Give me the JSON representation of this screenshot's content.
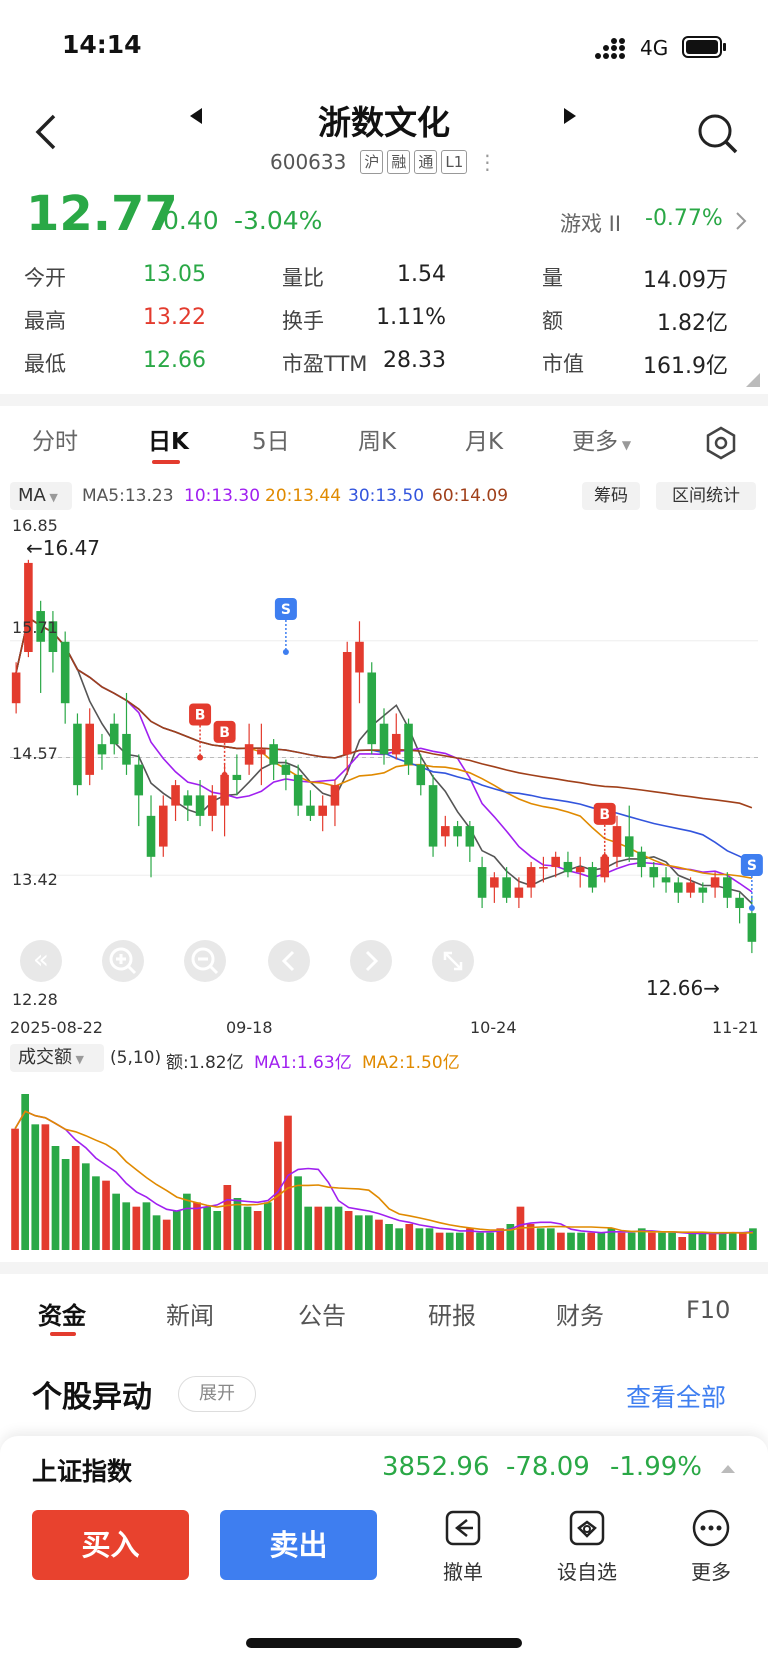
{
  "status_bar": {
    "time": "14:14",
    "network": "4G"
  },
  "header": {
    "title": "浙数文化",
    "code": "600633",
    "tags": [
      "沪",
      "融",
      "通",
      "L1"
    ]
  },
  "quote": {
    "price": "12.77",
    "change": "-0.40",
    "change_pct": "-3.04%",
    "sector": "游戏 II",
    "sector_pct": "-0.77%"
  },
  "stats": [
    [
      {
        "label": "今开",
        "value": "13.05",
        "color": "#2aa846"
      },
      {
        "label": "量比",
        "value": "1.54",
        "color": "#222222"
      },
      {
        "label": "量",
        "value": "14.09万",
        "color": "#222222"
      }
    ],
    [
      {
        "label": "最高",
        "value": "13.22",
        "color": "#e33b2e"
      },
      {
        "label": "换手",
        "value": "1.11%",
        "color": "#222222"
      },
      {
        "label": "额",
        "value": "1.82亿",
        "color": "#222222"
      }
    ],
    [
      {
        "label": "最低",
        "value": "12.66",
        "color": "#2aa846"
      },
      {
        "label": "市盈TTM",
        "value": "28.33",
        "color": "#222222"
      },
      {
        "label": "市值",
        "value": "161.9亿",
        "color": "#222222"
      }
    ]
  ],
  "chart_tabs": [
    "分时",
    "日K",
    "5日",
    "周K",
    "月K",
    "更多"
  ],
  "active_chart_tab": "日K",
  "ma_bar": {
    "selector": "MA",
    "ma5": "MA5:13.23",
    "ma10": "10:13.30",
    "ma20": "20:13.44",
    "ma30": "30:13.50",
    "ma60": "60:14.09",
    "chip_btn": "筹码",
    "range_btn": "区间统计"
  },
  "kline_axis": {
    "y_top": "16.85",
    "y_mid": "14.57",
    "y_low": "13.42",
    "y_bottom": "12.28",
    "y_upper": "15.71",
    "high_marker": "←16.47",
    "low_marker": "12.66→",
    "dates": [
      "2025-08-22",
      "09-18",
      "10-24",
      "11-21"
    ]
  },
  "trade_markers": [
    "B",
    "B",
    "S",
    "B",
    "S"
  ],
  "volume_bar": {
    "selector": "成交额",
    "params": "(5,10)",
    "amount": "额:1.82亿",
    "ma1": "MA1:1.63亿",
    "ma2": "MA2:1.50亿"
  },
  "colors": {
    "up": "#e33b2e",
    "down": "#2aa846",
    "ma5": "#555555",
    "ma10": "#a020f0",
    "ma20": "#e08a00",
    "ma30": "#3355dd",
    "ma60": "#a0401a"
  },
  "chart_data": {
    "type": "candlestick",
    "y_range": [
      12.28,
      16.85
    ],
    "candles": [
      [
        15.1,
        15.4,
        15.5,
        15.0
      ],
      [
        15.6,
        16.47,
        16.5,
        15.55
      ],
      [
        16.0,
        15.7,
        16.1,
        15.2
      ],
      [
        15.9,
        15.6,
        16.0,
        15.4
      ],
      [
        15.7,
        15.1,
        15.8,
        14.9
      ],
      [
        14.9,
        14.3,
        15.0,
        14.2
      ],
      [
        14.4,
        14.9,
        15.05,
        14.3
      ],
      [
        14.7,
        14.6,
        14.8,
        14.45
      ],
      [
        14.9,
        14.7,
        15.0,
        14.6
      ],
      [
        14.8,
        14.5,
        15.2,
        14.4
      ],
      [
        14.5,
        14.2,
        14.6,
        13.9
      ],
      [
        14.0,
        13.6,
        14.2,
        13.4
      ],
      [
        13.7,
        14.1,
        14.2,
        13.6
      ],
      [
        14.1,
        14.3,
        14.35,
        13.95
      ],
      [
        14.2,
        14.1,
        14.25,
        13.95
      ],
      [
        14.2,
        14.0,
        14.35,
        13.9
      ],
      [
        14.0,
        14.2,
        14.3,
        13.85
      ],
      [
        14.1,
        14.4,
        14.5,
        13.8
      ],
      [
        14.4,
        14.35,
        14.6,
        14.2
      ],
      [
        14.5,
        14.7,
        14.9,
        14.4
      ],
      [
        14.6,
        14.65,
        14.9,
        14.3
      ],
      [
        14.7,
        14.5,
        14.75,
        14.35
      ],
      [
        14.5,
        14.4,
        14.55,
        14.25
      ],
      [
        14.4,
        14.1,
        14.5,
        14.0
      ],
      [
        14.1,
        14.0,
        14.25,
        13.95
      ],
      [
        14.0,
        14.1,
        14.2,
        13.85
      ],
      [
        14.1,
        14.3,
        14.35,
        13.9
      ],
      [
        14.6,
        15.6,
        15.7,
        14.4
      ],
      [
        15.4,
        15.7,
        15.9,
        15.1
      ],
      [
        15.4,
        14.7,
        15.5,
        14.6
      ],
      [
        14.9,
        14.6,
        15.05,
        14.5
      ],
      [
        14.6,
        14.8,
        15.0,
        14.55
      ],
      [
        14.9,
        14.5,
        14.95,
        14.4
      ],
      [
        14.5,
        14.3,
        14.6,
        14.2
      ],
      [
        14.3,
        13.7,
        14.4,
        13.6
      ],
      [
        13.8,
        13.9,
        14.0,
        13.7
      ],
      [
        13.9,
        13.8,
        13.95,
        13.7
      ],
      [
        13.9,
        13.7,
        13.95,
        13.55
      ],
      [
        13.5,
        13.2,
        13.6,
        13.1
      ],
      [
        13.3,
        13.4,
        13.45,
        13.15
      ],
      [
        13.4,
        13.2,
        13.5,
        13.15
      ],
      [
        13.2,
        13.3,
        13.4,
        13.1
      ],
      [
        13.3,
        13.5,
        13.55,
        13.2
      ],
      [
        13.5,
        13.5,
        13.6,
        13.35
      ],
      [
        13.5,
        13.6,
        13.65,
        13.4
      ],
      [
        13.55,
        13.45,
        13.65,
        13.4
      ],
      [
        13.45,
        13.5,
        13.6,
        13.3
      ],
      [
        13.5,
        13.3,
        13.55,
        13.25
      ],
      [
        13.4,
        13.6,
        13.65,
        13.35
      ],
      [
        13.6,
        13.9,
        14.0,
        13.5
      ],
      [
        13.8,
        13.6,
        14.1,
        13.55
      ],
      [
        13.65,
        13.5,
        13.7,
        13.4
      ],
      [
        13.5,
        13.4,
        13.55,
        13.3
      ],
      [
        13.4,
        13.35,
        13.5,
        13.25
      ],
      [
        13.35,
        13.25,
        13.4,
        13.15
      ],
      [
        13.25,
        13.35,
        13.4,
        13.2
      ],
      [
        13.3,
        13.25,
        13.35,
        13.15
      ],
      [
        13.3,
        13.4,
        13.45,
        13.2
      ],
      [
        13.4,
        13.2,
        13.45,
        13.1
      ],
      [
        13.2,
        13.1,
        13.25,
        12.95
      ],
      [
        13.05,
        12.77,
        13.22,
        12.66
      ]
    ],
    "volume": [
      2.8,
      3.6,
      2.9,
      2.9,
      2.4,
      2.1,
      2.4,
      2.0,
      1.7,
      1.6,
      1.3,
      1.1,
      1.0,
      1.1,
      0.8,
      0.7,
      0.9,
      1.3,
      1.1,
      1.0,
      0.9,
      1.5,
      1.2,
      1.0,
      0.9,
      1.1,
      2.5,
      3.1,
      1.7,
      1.0,
      1.0,
      1.0,
      1.0,
      0.9,
      0.8,
      0.8,
      0.7,
      0.6,
      0.5,
      0.6,
      0.5,
      0.5,
      0.4,
      0.4,
      0.4,
      0.5,
      0.4,
      0.4,
      0.5,
      0.6,
      1.0,
      0.6,
      0.5,
      0.5,
      0.4,
      0.4,
      0.4,
      0.4,
      0.4,
      0.5,
      0.4,
      0.4,
      0.5,
      0.4,
      0.4,
      0.4,
      0.3,
      0.4,
      0.4,
      0.4,
      0.4,
      0.4,
      0.4,
      0.5
    ]
  },
  "bottom_tabs": [
    "资金",
    "新闻",
    "公告",
    "研报",
    "财务",
    "F10"
  ],
  "movement": {
    "title": "个股异动",
    "expand": "展开",
    "view_all": "查看全部"
  },
  "index_bar": {
    "name": "上证指数",
    "value": "3852.96",
    "change": "-78.09",
    "pct": "-1.99%"
  },
  "actions": {
    "buy": "买入",
    "sell": "卖出",
    "cancel": "撤单",
    "watch": "设自选",
    "more": "更多"
  }
}
